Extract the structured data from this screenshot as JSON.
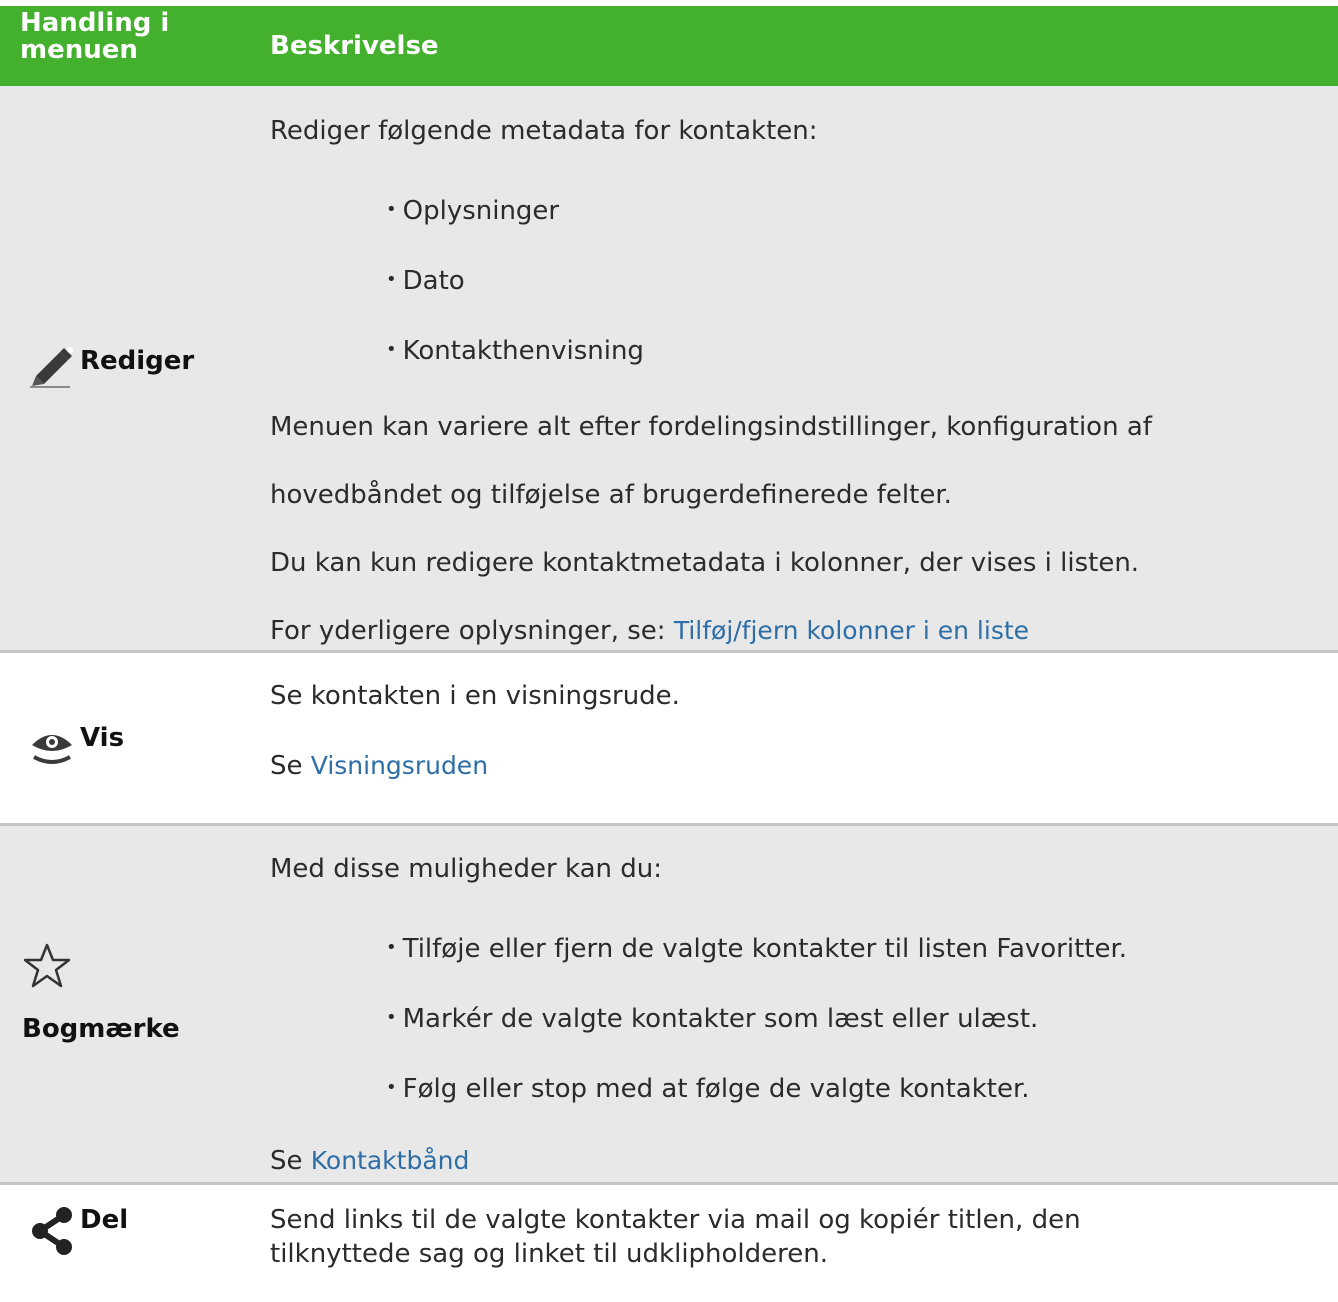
{
  "header": {
    "col1": "Handling i menuen",
    "col2": "Beskrivelse"
  },
  "rows": {
    "rediger": {
      "action": "Rediger",
      "icon": "pencil-icon",
      "intro": "Rediger følgende metadata for kontakten:",
      "items": [
        "Oplysninger",
        "Dato",
        "Kontakthenvisning"
      ],
      "note1_line1": "Menuen kan variere alt efter fordelingsindstillinger, konfiguration af",
      "note1_line2": "hovedbåndet og tilføjelse af brugerdefinerede felter.",
      "note2": "Du kan kun redigere kontaktmetadata i kolonner, der vises i listen.",
      "more_prefix": "For yderligere oplysninger, se:",
      "more_link": "Tilføj/fjern kolonner i en liste"
    },
    "vis": {
      "action": "Vis",
      "icon": "eye-icon",
      "text": "Se kontakten i en visningsrude.",
      "see_prefix": "Se",
      "see_link": "Visningsruden"
    },
    "bogmaerke": {
      "action": "Bogmærke",
      "icon": "star-icon",
      "intro": "Med disse muligheder kan du:",
      "items": [
        "Tilføje eller fjern de valgte kontakter til listen Favoritter.",
        "Markér de valgte kontakter som læst eller ulæst.",
        "Følg eller stop med at følge de valgte kontakter."
      ],
      "see_prefix": "Se",
      "see_link": "Kontaktbånd"
    },
    "del": {
      "action": "Del",
      "icon": "share-icon",
      "text_line1": "Send links til de valgte kontakter via mail og kopiér titlen, den",
      "text_line2": "tilknyttede sag og linket til udklipholderen."
    }
  },
  "colors": {
    "header_bg": "#43b12e",
    "row_bg": "#e8e8e8",
    "link": "#2e6ea6",
    "separator": "#c4c4c4"
  }
}
